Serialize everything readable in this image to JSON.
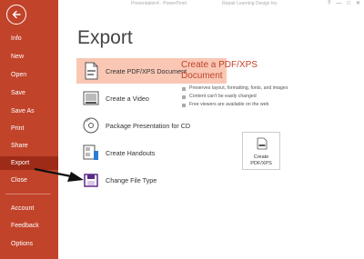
{
  "window": {
    "doc_name": "Presentation4 - PowerPoint",
    "user_name": "Repair Learning Design Inc",
    "controls": [
      "?",
      "—",
      "□",
      "✕"
    ]
  },
  "sidebar": {
    "items": [
      {
        "label": "Info"
      },
      {
        "label": "New"
      },
      {
        "label": "Open"
      },
      {
        "label": "Save"
      },
      {
        "label": "Save As"
      },
      {
        "label": "Print"
      },
      {
        "label": "Share"
      },
      {
        "label": "Export",
        "active": true
      },
      {
        "label": "Close"
      },
      {
        "label": "Account"
      },
      {
        "label": "Feedback"
      },
      {
        "label": "Options"
      }
    ]
  },
  "page": {
    "title": "Export"
  },
  "export_options": [
    {
      "label": "Create PDF/XPS Document",
      "icon": "pdf-document-icon",
      "selected": true
    },
    {
      "label": "Create a Video",
      "icon": "video-icon"
    },
    {
      "label": "Package Presentation for CD",
      "icon": "cd-icon"
    },
    {
      "label": "Create Handouts",
      "icon": "handouts-icon"
    },
    {
      "label": "Change File Type",
      "icon": "file-type-icon"
    }
  ],
  "detail": {
    "title": "Create a PDF/XPS Document",
    "bullets": [
      "Preserves layout, formatting, fonts, and images",
      "Content can't be easily changed",
      "Free viewers are available on the web"
    ],
    "button": {
      "line1": "Create",
      "line2": "PDF/XPS"
    }
  },
  "colors": {
    "accent": "#c1432a",
    "sidebar_active": "#9e2b17",
    "selected_bg": "#f9c7b4"
  }
}
